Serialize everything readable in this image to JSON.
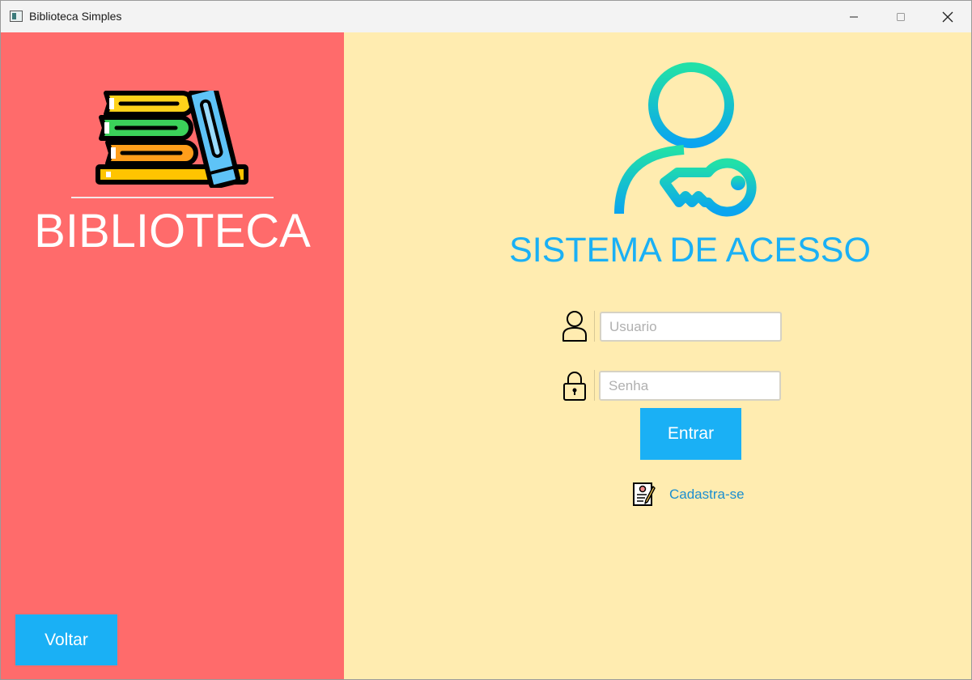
{
  "window": {
    "title": "Biblioteca Simples"
  },
  "left_panel": {
    "brand": "BIBLIOTECA",
    "back_button": "Voltar"
  },
  "login": {
    "title": "SISTEMA DE ACESSO",
    "username_placeholder": "Usuario",
    "password_placeholder": "Senha",
    "enter_button": "Entrar",
    "register_link": "Cadastra-se"
  },
  "colors": {
    "left_bg": "#ff6b6b",
    "right_bg": "#ffecb0",
    "accent": "#1ab0f5"
  },
  "icons": [
    "books-icon",
    "user-key-icon",
    "user-icon",
    "lock-icon",
    "register-form-icon"
  ]
}
